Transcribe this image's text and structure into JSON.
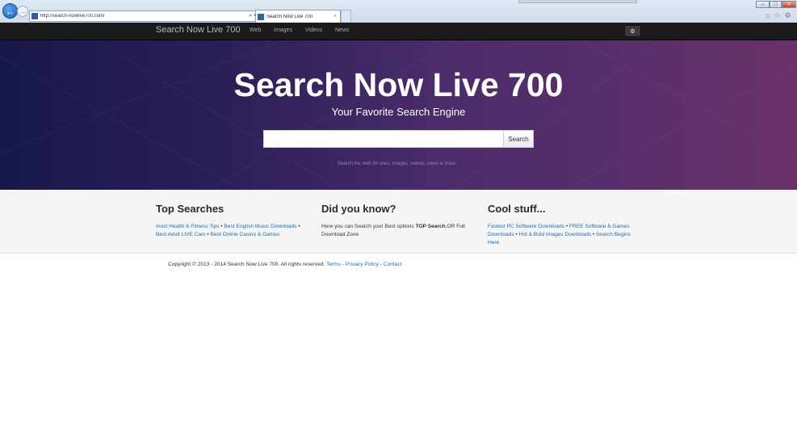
{
  "browser": {
    "url": "http://search-nowlive700.com/",
    "address_tools": "⌕ ▾ ↻",
    "tab_title": "Search Now Live 700",
    "tab_close": "×",
    "back_glyph": "←",
    "forward_glyph": "→",
    "window_min": "–",
    "window_max": "□",
    "window_close": "×",
    "home_glyph": "⌂",
    "favorites_glyph": "☆",
    "tools_glyph": "⚙"
  },
  "navbar": {
    "brand": "Search Now Live 700",
    "items": [
      "Web",
      "Images",
      "Videos",
      "News"
    ],
    "gear_glyph": "⚙"
  },
  "hero": {
    "title": "Search Now Live 700",
    "subtitle": "Your Favorite Search Engine",
    "search_value": "",
    "search_button": "Search",
    "hint": "Search the web for sites, images, videos, news & more..."
  },
  "info": {
    "top_searches": {
      "heading": "Top Searches",
      "links": [
        "most Health & Fitness Tips",
        "Best English Music Downloads",
        "Best Adult LIVE Cam",
        "Best Online Casino & Games"
      ],
      "separator": " • "
    },
    "did_you_know": {
      "heading": "Did you know?",
      "text_before": "Here you can Search your Best options ",
      "text_bold": "TOP Search",
      "text_after": ",OR Full Download Zone"
    },
    "cool_stuff": {
      "heading": "Cool stuff...",
      "links": [
        "Fastest PC Software Downloads",
        "FREE Software & Games Downloads",
        "Hot & Bold Images Downloads",
        "Search Begins Here"
      ],
      "separator": " • "
    }
  },
  "footer": {
    "copyright": "Copyright © 2013 - 2014 Search Now Live 700. All rights reserved. ",
    "links": [
      "Terms",
      "Privacy Policy",
      "Contact"
    ],
    "separator": " - "
  },
  "colors": {
    "link": "#1a6fb3",
    "navbar_bg": "#1b1b1b",
    "hero_left": "#17184a",
    "hero_right": "#6a3168"
  }
}
